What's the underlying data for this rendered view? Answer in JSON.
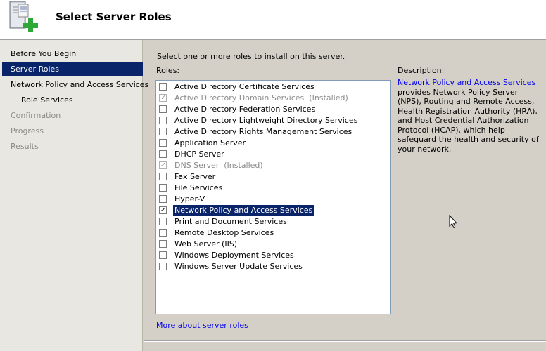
{
  "header": {
    "title": "Select Server Roles"
  },
  "sidebar": {
    "items": [
      {
        "label": "Before You Begin",
        "state": "normal",
        "sub": false
      },
      {
        "label": "Server Roles",
        "state": "selected",
        "sub": false
      },
      {
        "label": "Network Policy and Access Services",
        "state": "normal",
        "sub": false
      },
      {
        "label": "Role Services",
        "state": "normal",
        "sub": true
      },
      {
        "label": "Confirmation",
        "state": "disabled",
        "sub": false
      },
      {
        "label": "Progress",
        "state": "disabled",
        "sub": false
      },
      {
        "label": "Results",
        "state": "disabled",
        "sub": false
      }
    ]
  },
  "main": {
    "instruction": "Select one or more roles to install on this server.",
    "roles_label": "Roles:",
    "roles": [
      {
        "label": "Active Directory Certificate Services",
        "checked": false,
        "disabled": false,
        "installed": ""
      },
      {
        "label": "Active Directory Domain Services",
        "checked": true,
        "disabled": true,
        "installed": "(Installed)"
      },
      {
        "label": "Active Directory Federation Services",
        "checked": false,
        "disabled": false,
        "installed": ""
      },
      {
        "label": "Active Directory Lightweight Directory Services",
        "checked": false,
        "disabled": false,
        "installed": ""
      },
      {
        "label": "Active Directory Rights Management Services",
        "checked": false,
        "disabled": false,
        "installed": ""
      },
      {
        "label": "Application Server",
        "checked": false,
        "disabled": false,
        "installed": ""
      },
      {
        "label": "DHCP Server",
        "checked": false,
        "disabled": false,
        "installed": ""
      },
      {
        "label": "DNS Server",
        "checked": true,
        "disabled": true,
        "installed": "(Installed)"
      },
      {
        "label": "Fax Server",
        "checked": false,
        "disabled": false,
        "installed": ""
      },
      {
        "label": "File Services",
        "checked": false,
        "disabled": false,
        "installed": ""
      },
      {
        "label": "Hyper-V",
        "checked": false,
        "disabled": false,
        "installed": ""
      },
      {
        "label": "Network Policy and Access Services",
        "checked": true,
        "disabled": false,
        "installed": "",
        "selected": true
      },
      {
        "label": "Print and Document Services",
        "checked": false,
        "disabled": false,
        "installed": ""
      },
      {
        "label": "Remote Desktop Services",
        "checked": false,
        "disabled": false,
        "installed": ""
      },
      {
        "label": "Web Server (IIS)",
        "checked": false,
        "disabled": false,
        "installed": ""
      },
      {
        "label": "Windows Deployment Services",
        "checked": false,
        "disabled": false,
        "installed": ""
      },
      {
        "label": "Windows Server Update Services",
        "checked": false,
        "disabled": false,
        "installed": ""
      }
    ],
    "more_link": "More about server roles"
  },
  "description": {
    "label": "Description:",
    "link_text": "Network Policy and Access Services",
    "text": "provides Network Policy Server (NPS), Routing and Remote Access, Health Registration Authority (HRA), and Host Credential Authorization Protocol (HCAP), which help safeguard the health and security of your network."
  },
  "colors": {
    "selection": "#0a246a",
    "link": "#0000ee",
    "sidebar_bg": "#e9e7e1"
  },
  "icons": {
    "header": "server-add-icon",
    "cursor": "mouse-pointer-icon"
  }
}
